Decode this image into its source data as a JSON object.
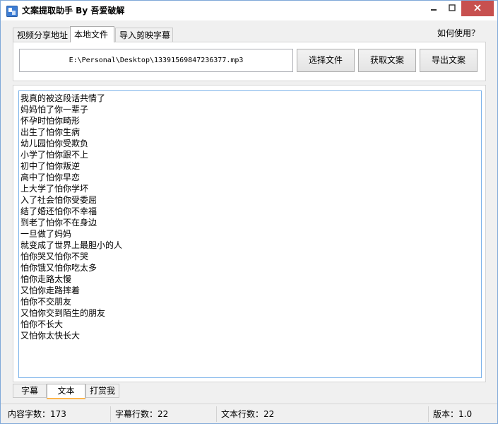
{
  "window": {
    "title": "文案提取助手 By 吾爱破解"
  },
  "tabs": [
    {
      "label": "视频分享地址",
      "active": false
    },
    {
      "label": "本地文件",
      "active": true
    },
    {
      "label": "导入剪映字幕",
      "active": false
    }
  ],
  "help": {
    "label": "如何使用？"
  },
  "file": {
    "path": "E:\\Personal\\Desktop\\13391569847236377.mp3",
    "select_label": "选择文件",
    "fetch_label": "获取文案",
    "export_label": "导出文案"
  },
  "content": {
    "lines": [
      "我真的被这段话共情了",
      "妈妈怕了你一辈子",
      "怀孕时怕你畸形",
      "出生了怕你生病",
      "幼儿园怕你受欺负",
      "小学了怕你跟不上",
      "初中了怕你叛逆",
      "高中了怕你早恋",
      "上大学了怕你学坏",
      "入了社会怕你受委屈",
      "结了婚还怕你不幸福",
      "到老了怕你不在身边",
      "一旦做了妈妈",
      "就变成了世界上最胆小的人",
      "怕你哭又怕你不哭",
      "怕你饿又怕你吃太多",
      "怕你走路太慢",
      "又怕你走路摔着",
      "怕你不交朋友",
      "又怕你交到陌生的朋友",
      "怕你不长大",
      "又怕你太快长大"
    ]
  },
  "bottom_tabs": [
    {
      "label": "字幕",
      "active": false
    },
    {
      "label": "文本",
      "active": true
    },
    {
      "label": "打赏我",
      "active": false
    }
  ],
  "status": {
    "char_count": "内容字数：173",
    "subtitle_lines": "字幕行数：22",
    "text_lines": "文本行数：22",
    "version": "版本：1.0"
  },
  "colors": {
    "close_button": "#c7504f",
    "text_area_border": "#7eb4ea",
    "active_tab_underline": "#ffb64c"
  },
  "icons": {
    "app": "app-icon",
    "minimize": "minimize-icon",
    "maximize": "maximize-icon",
    "close": "close-icon"
  }
}
